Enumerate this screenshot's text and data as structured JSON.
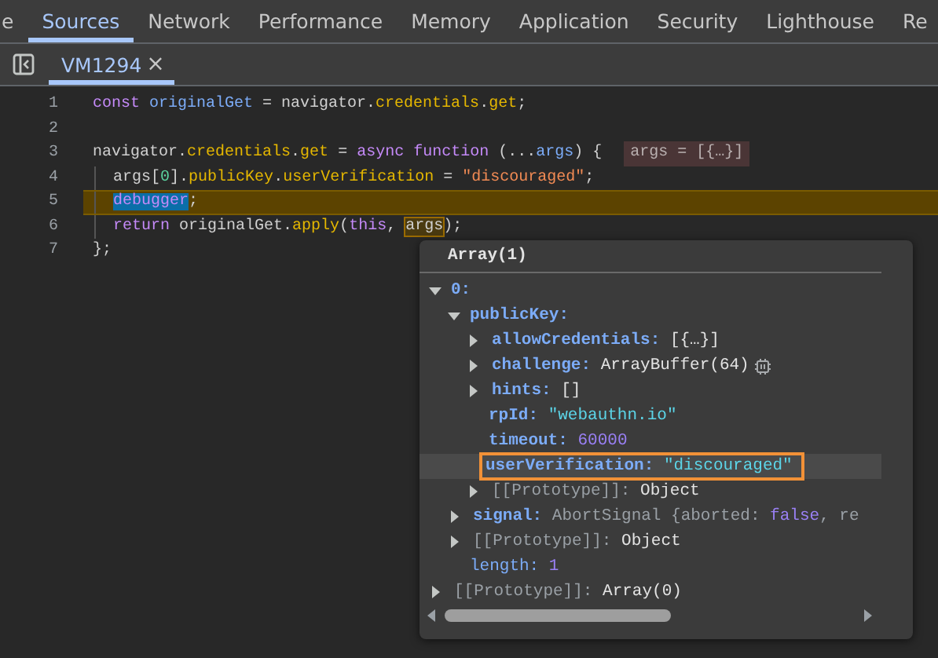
{
  "panel_tabs": [
    {
      "label": "e",
      "selected": false
    },
    {
      "label": "Sources",
      "selected": true
    },
    {
      "label": "Network",
      "selected": false
    },
    {
      "label": "Performance",
      "selected": false
    },
    {
      "label": "Memory",
      "selected": false
    },
    {
      "label": "Application",
      "selected": false
    },
    {
      "label": "Security",
      "selected": false
    },
    {
      "label": "Lighthouse",
      "selected": false
    },
    {
      "label": "Re",
      "selected": false
    }
  ],
  "file_tabs": [
    {
      "label": "VM1294",
      "close": "×",
      "selected": true
    }
  ],
  "code_lines": [
    {
      "number": "1",
      "paused": false,
      "segments": [
        {
          "text": "const ",
          "kind": "keyword"
        },
        {
          "text": "originalGet",
          "kind": "variable"
        },
        {
          "text": " = navigator.",
          "kind": "plain"
        },
        {
          "text": "credentials",
          "kind": "property"
        },
        {
          "text": ".",
          "kind": "plain"
        },
        {
          "text": "get",
          "kind": "property"
        },
        {
          "text": ";",
          "kind": "plain"
        }
      ]
    },
    {
      "number": "2",
      "paused": false
    },
    {
      "number": "3",
      "paused": false,
      "inline_value": "args = [{…}]",
      "segments": [
        {
          "text": "navigator.",
          "kind": "plain"
        },
        {
          "text": "credentials",
          "kind": "property"
        },
        {
          "text": ".",
          "kind": "plain"
        },
        {
          "text": "get",
          "kind": "property"
        },
        {
          "text": " = ",
          "kind": "plain"
        },
        {
          "text": "async function",
          "kind": "keyword"
        },
        {
          "text": " (...",
          "kind": "plain"
        },
        {
          "text": "args",
          "kind": "variable"
        },
        {
          "text": ") {",
          "kind": "plain"
        }
      ],
      "children": [
        {
          "number": "4",
          "paused": false,
          "segments": [
            {
              "text": "args[",
              "kind": "plain"
            },
            {
              "text": "0",
              "kind": "number"
            },
            {
              "text": "].",
              "kind": "plain"
            },
            {
              "text": "publicKey",
              "kind": "property"
            },
            {
              "text": ".",
              "kind": "plain"
            },
            {
              "text": "userVerification",
              "kind": "property"
            },
            {
              "text": " = ",
              "kind": "plain"
            },
            {
              "text": "\"discouraged\"",
              "kind": "string"
            },
            {
              "text": ";",
              "kind": "plain"
            }
          ]
        },
        {
          "number": "5",
          "paused": true,
          "segments": [
            {
              "text": "debugger",
              "kind": "selected_keyword"
            },
            {
              "text": ";",
              "kind": "plain"
            }
          ]
        },
        {
          "number": "6",
          "paused": false,
          "segments": [
            {
              "text": "return ",
              "kind": "keyword"
            },
            {
              "text": "originalGet.",
              "kind": "plain"
            },
            {
              "text": "apply",
              "kind": "property"
            },
            {
              "text": "(",
              "kind": "plain"
            },
            {
              "text": "this",
              "kind": "keyword"
            },
            {
              "text": ", ",
              "kind": "plain"
            },
            {
              "text": "args",
              "kind": "hovered"
            },
            {
              "text": ");",
              "kind": "plain"
            }
          ]
        }
      ]
    },
    {
      "number": "7",
      "paused": false,
      "segments": [
        {
          "text": "};",
          "kind": "plain"
        }
      ]
    }
  ],
  "popover": {
    "title": "Array(1)",
    "nodes": [
      {
        "key": "0:",
        "kind": "own_property",
        "expanded": true,
        "outlined": false,
        "children": [
          {
            "key": "publicKey:",
            "kind": "own_property",
            "expanded": true,
            "outlined": false,
            "children": [
              {
                "key": "allowCredentials:",
                "kind": "own_property",
                "expanded": false,
                "outlined": false,
                "value": [
                  {
                    "text": "[{…}]",
                    "kind": "object"
                  }
                ]
              },
              {
                "key": "challenge:",
                "kind": "own_property",
                "expanded": false,
                "outlined": false,
                "value": [
                  {
                    "text": "ArrayBuffer(64)",
                    "kind": "object"
                  },
                  {
                    "kind": "memory_icon"
                  }
                ]
              },
              {
                "key": "hints:",
                "kind": "own_property",
                "expanded": false,
                "outlined": false,
                "value": [
                  {
                    "text": "[]",
                    "kind": "object"
                  }
                ]
              },
              {
                "key": "rpId:",
                "kind": "own_property",
                "outlined": false,
                "value": [
                  {
                    "text": "\"webauthn.io\"",
                    "kind": "string"
                  }
                ]
              },
              {
                "key": "timeout:",
                "kind": "own_property",
                "outlined": false,
                "value": [
                  {
                    "text": "60000",
                    "kind": "number"
                  }
                ]
              },
              {
                "key": "userVerification:",
                "kind": "own_property",
                "outlined": true,
                "value": [
                  {
                    "text": "\"discouraged\"",
                    "kind": "string"
                  }
                ]
              },
              {
                "key": "[[Prototype]]:",
                "kind": "internal_slot",
                "expanded": false,
                "outlined": false,
                "value": [
                  {
                    "text": "Object",
                    "kind": "object"
                  }
                ]
              }
            ]
          },
          {
            "key": "signal:",
            "kind": "own_property",
            "expanded": false,
            "outlined": false,
            "value": [
              {
                "text": "AbortSignal {aborted: ",
                "kind": "preview"
              },
              {
                "text": "false",
                "kind": "number"
              },
              {
                "text": ", re",
                "kind": "preview"
              }
            ]
          },
          {
            "key": "[[Prototype]]:",
            "kind": "internal_slot",
            "expanded": false,
            "outlined": false,
            "value": [
              {
                "text": "Object",
                "kind": "object"
              }
            ]
          },
          {
            "key": "length:",
            "kind": "non_enumerable",
            "outlined": false,
            "value": [
              {
                "text": "1",
                "kind": "number"
              }
            ]
          }
        ]
      },
      {
        "key": "[[Prototype]]:",
        "kind": "internal_slot",
        "expanded": false,
        "outlined": false,
        "value": [
          {
            "text": "Array(0)",
            "kind": "object"
          }
        ]
      }
    ]
  }
}
